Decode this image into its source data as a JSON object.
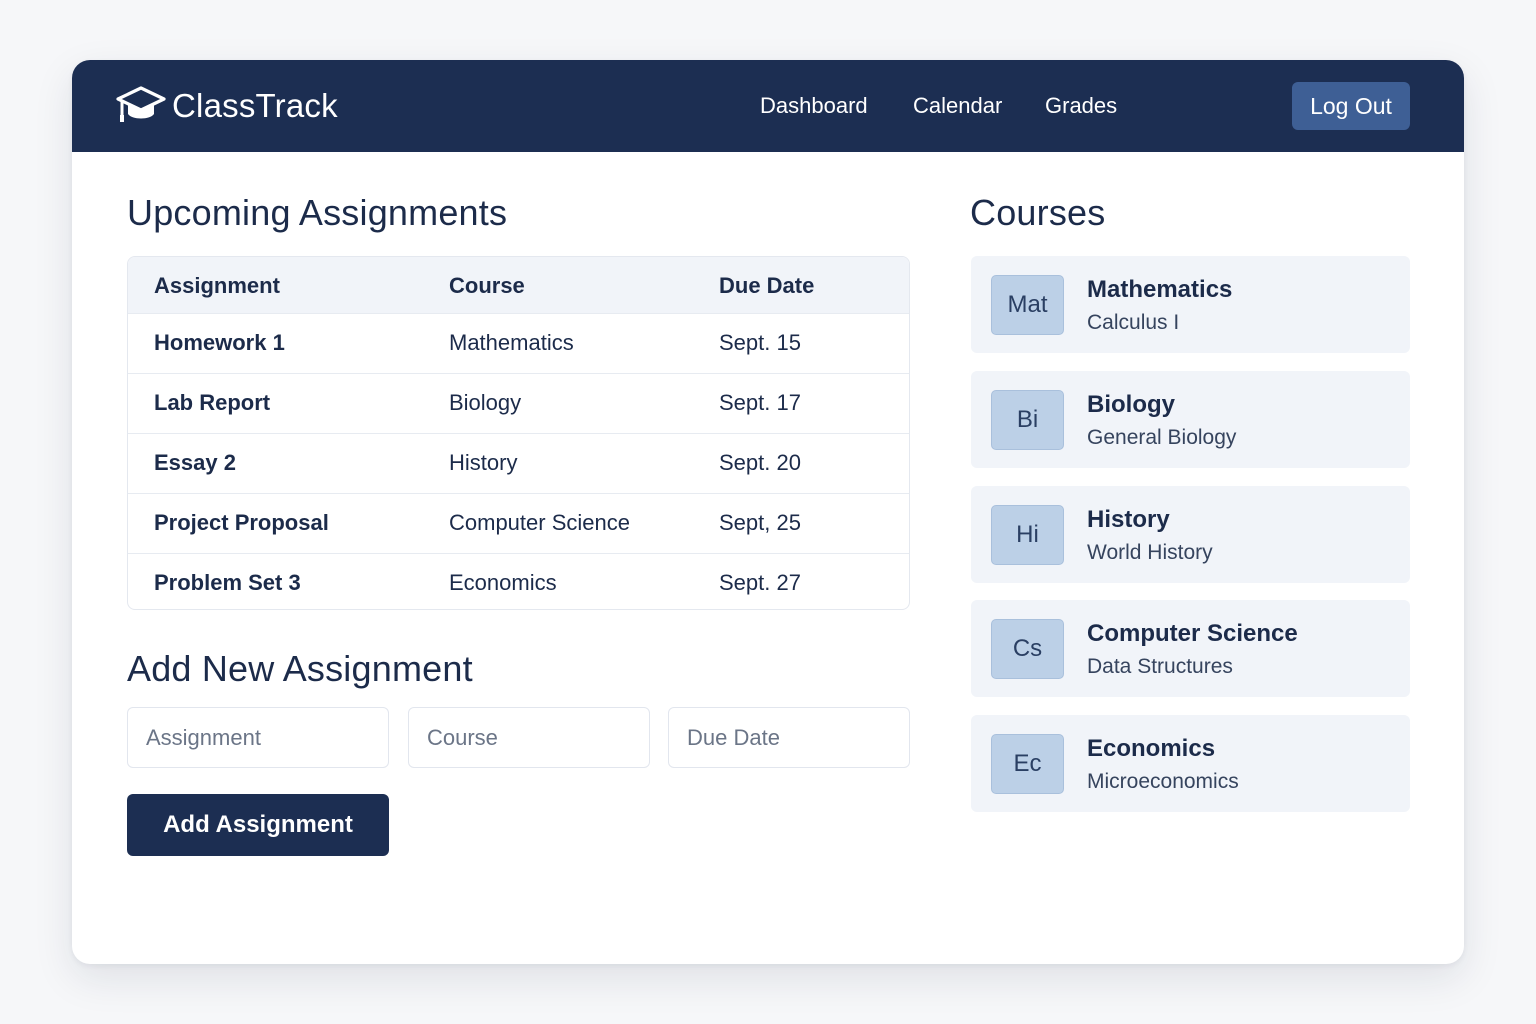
{
  "app": {
    "name": "ClassTrack",
    "logo_icon": "graduation-cap-icon"
  },
  "nav": {
    "items": [
      "Dashboard",
      "Calendar",
      "Grades"
    ],
    "logout_label": "Log Out"
  },
  "assignments": {
    "title": "Upcoming Assignments",
    "columns": [
      "Assignment",
      "Course",
      "Due Date"
    ],
    "rows": [
      {
        "assignment": "Homework 1",
        "course": "Mathematics",
        "due": "Sept. 15"
      },
      {
        "assignment": "Lab Report",
        "course": "Biology",
        "due": "Sept. 17"
      },
      {
        "assignment": "Essay 2",
        "course": "History",
        "due": "Sept. 20"
      },
      {
        "assignment": "Project Proposal",
        "course": "Computer Science",
        "due": "Sept, 25"
      },
      {
        "assignment": "Problem Set 3",
        "course": "Economics",
        "due": "Sept. 27"
      }
    ]
  },
  "add_form": {
    "title": "Add New Assignment",
    "assignment_placeholder": "Assignment",
    "course_placeholder": "Course",
    "due_placeholder": "Due Date",
    "submit_label": "Add Assignment"
  },
  "courses": {
    "title": "Courses",
    "items": [
      {
        "badge": "Mat",
        "name": "Mathematics",
        "subtitle": "Calculus I"
      },
      {
        "badge": "Bi",
        "name": "Biology",
        "subtitle": "General Biology"
      },
      {
        "badge": "Hi",
        "name": "History",
        "subtitle": "World History"
      },
      {
        "badge": "Cs",
        "name": "Computer Science",
        "subtitle": "Data Structures"
      },
      {
        "badge": "Ec",
        "name": "Economics",
        "subtitle": "Microeconomics"
      }
    ]
  },
  "colors": {
    "primary": "#1c2e52",
    "logout_button": "#3e5f95",
    "badge": "#bcd0e7",
    "card_background": "#f1f4f9"
  }
}
